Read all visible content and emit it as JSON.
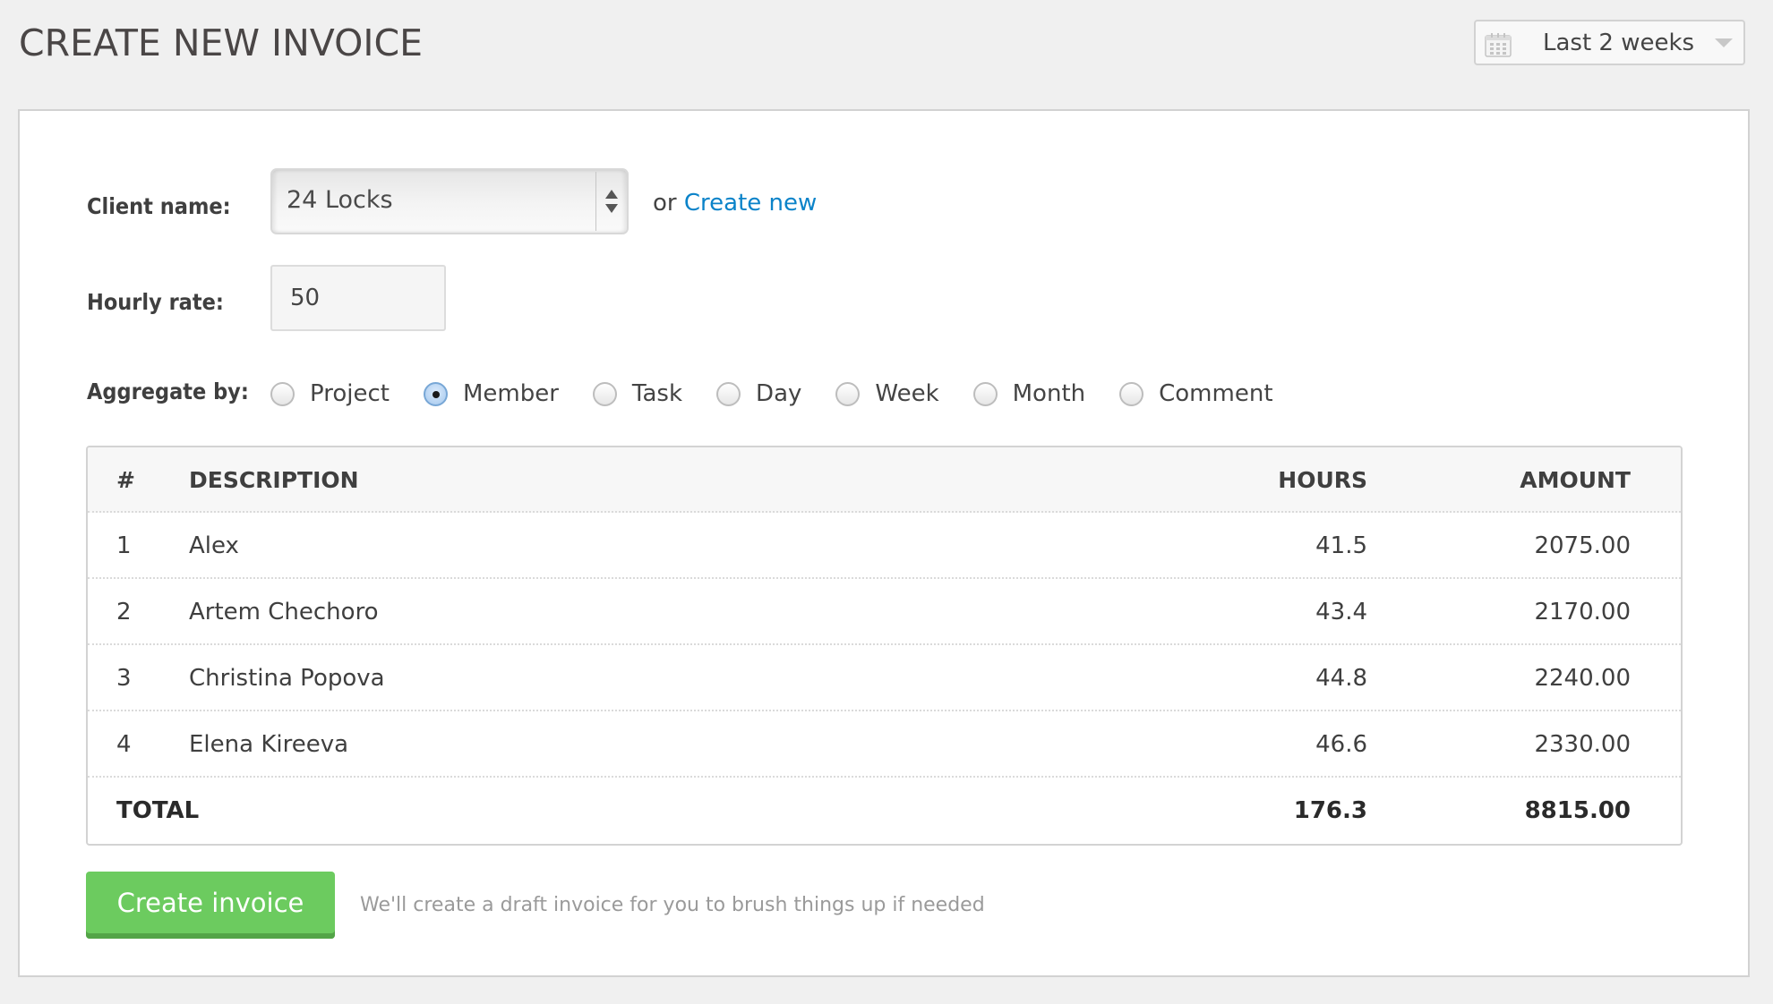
{
  "header": {
    "title": "CREATE NEW INVOICE",
    "date_range": {
      "icon": "calendar-icon",
      "selected": "Last 2 weeks",
      "caret_icon": "chevron-down-icon"
    }
  },
  "form": {
    "client": {
      "label": "Client name:",
      "selected": "24 Locks",
      "or_text": "or",
      "create_link": "Create new"
    },
    "rate": {
      "label": "Hourly rate:",
      "value": "50"
    },
    "aggregate": {
      "label": "Aggregate by:",
      "selected": "Member",
      "options": [
        {
          "label": "Project",
          "checked": false
        },
        {
          "label": "Member",
          "checked": true
        },
        {
          "label": "Task",
          "checked": false
        },
        {
          "label": "Day",
          "checked": false
        },
        {
          "label": "Week",
          "checked": false
        },
        {
          "label": "Month",
          "checked": false
        },
        {
          "label": "Comment",
          "checked": false
        }
      ]
    }
  },
  "table": {
    "headers": {
      "num": "#",
      "description": "DESCRIPTION",
      "hours": "HOURS",
      "amount": "AMOUNT"
    },
    "rows": [
      {
        "num": "1",
        "description": "Alex",
        "hours": "41.5",
        "amount": "2075.00"
      },
      {
        "num": "2",
        "description": "Artem Chechoro",
        "hours": "43.4",
        "amount": "2170.00"
      },
      {
        "num": "3",
        "description": "Christina Popova",
        "hours": "44.8",
        "amount": "2240.00"
      },
      {
        "num": "4",
        "description": "Elena Kireeva",
        "hours": "46.6",
        "amount": "2330.00"
      }
    ],
    "total": {
      "label": "TOTAL",
      "hours": "176.3",
      "amount": "8815.00"
    }
  },
  "actions": {
    "create_button": "Create invoice",
    "helper_text": "We'll create a draft invoice for you to brush things up if needed"
  },
  "colors": {
    "accent_link": "#0b83c9",
    "button_green": "#6ccb5f",
    "button_green_shadow": "#53a447",
    "page_bg": "#f0f0f0"
  }
}
